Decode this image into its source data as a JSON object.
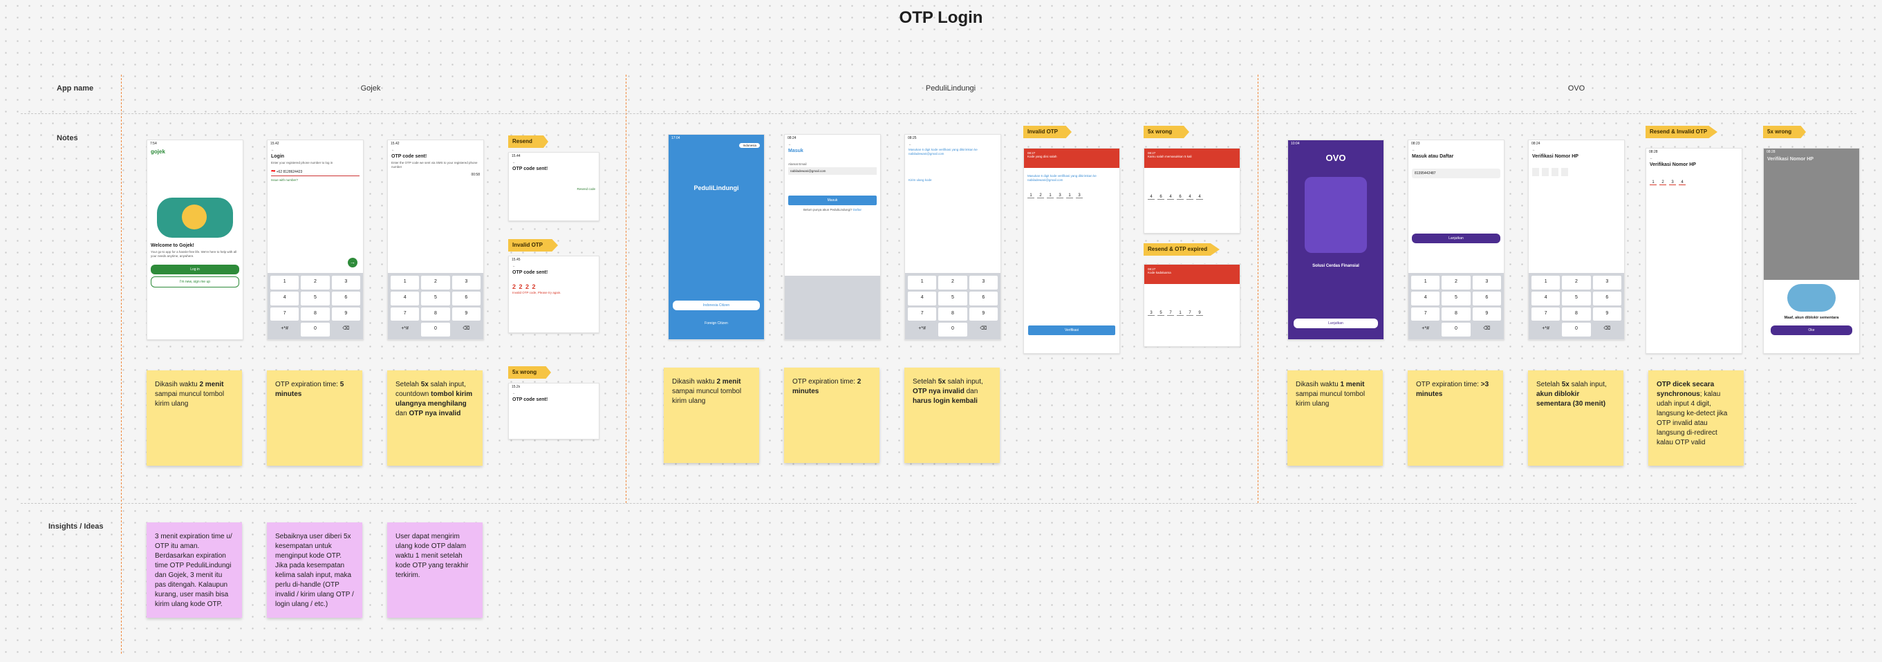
{
  "page_title": "OTP Login",
  "row_labels": {
    "app_name": "App name",
    "notes": "Notes",
    "insights": "Insights / Ideas"
  },
  "sections": [
    "Gojek",
    "PeduliLindungi",
    "OVO"
  ],
  "tags": {
    "resend": "Resend",
    "invalid_otp": "Invalid OTP",
    "five_wrong": "5x wrong",
    "resend_otp_expired": "Resend & OTP expired",
    "resend_invalid_otp": "Resend & Invalid OTP"
  },
  "screens": {
    "gojek_welcome": {
      "time": "7:54",
      "brand": "gojek",
      "heading": "Welcome to Gojek!",
      "text": "Your go-to app for a hassle-free life. We're here to help with all your needs anytime, anywhere.",
      "login": "Log in",
      "signup": "I'm new, sign me up"
    },
    "gojek_login": {
      "time": "15.42",
      "heading": "Login",
      "text": "Enter your registered phone number to log in",
      "phone": "8128624423",
      "link": "Issue with number?"
    },
    "gojek_otp_sent": {
      "time": "15.42",
      "heading": "OTP code sent!",
      "text": "Enter the OTP code we sent via SMS to your registered phone number",
      "timer": "00:58"
    },
    "gojek_resend": {
      "time": "15.44",
      "heading": "OTP code sent!",
      "link": "Resend code"
    },
    "gojek_invalid": {
      "time": "15.45",
      "heading": "OTP code sent!",
      "code": "2 2 2 2",
      "error": "Invalid OTP code, Please try again."
    },
    "gojek_wrong": {
      "time": "15.2x",
      "heading": "OTP code sent!"
    },
    "peduli_splash": {
      "time": "17:04",
      "brand": "PeduliLindungi",
      "lang": "Indonesia",
      "primary": "Indonesia Citizen",
      "secondary": "Foreign Citizen"
    },
    "peduli_login": {
      "time": "08:24",
      "heading": "Masuk",
      "field_label": "Alamat Email",
      "field_value": "nabiladewani@gmail.com",
      "button": "Masuk",
      "link": "Belum punya akun PeduliLindungi?",
      "link_action": "Daftar"
    },
    "peduli_otp": {
      "time": "08:25",
      "text": "Masukan 6 digit kode verifikasi yang dikirimkan ke nabiladewani@gmail.com",
      "link": "Kirim ulang kode"
    },
    "peduli_invalid": {
      "time": "08:27",
      "error": "Kode yang diisi salah",
      "text": "Masukan 6 digit kode verifikasi yang dikirimkan ke nabiladewani@gmail.com",
      "digits": [
        "1",
        "2",
        "1",
        "3",
        "1",
        "3"
      ],
      "button": "Verifikasi"
    },
    "peduli_wrong": {
      "time": "08:27",
      "error": "Kamu salah memasukkan 5 kali",
      "digits": [
        "4",
        "6",
        "4",
        "6",
        "4",
        "4"
      ]
    },
    "peduli_expired": {
      "time": "08:27",
      "error": "Kode kadaluarsa",
      "digits": [
        "3",
        "5",
        "7",
        "1",
        "7",
        "9"
      ]
    },
    "ovo_splash": {
      "time": "10:04",
      "brand": "OVO",
      "tagline": "Solusi Cerdas Finansial",
      "button": "Lanjutkan"
    },
    "ovo_register": {
      "time": "08:23",
      "heading": "Masuk atau Daftar",
      "phone": "81395442487",
      "button": "Lanjutkan"
    },
    "ovo_verify": {
      "time": "08:24",
      "heading": "Verifikasi Nomor HP"
    },
    "ovo_invalid": {
      "time": "08:28",
      "heading": "Verifikasi Nomor HP",
      "digits": [
        "1",
        "2",
        "3",
        "4"
      ]
    },
    "ovo_blocked": {
      "time": "08:28",
      "heading": "Verifikasi Nomor HP",
      "message": "Maaf, akun diblokir sementara",
      "button": "Oke"
    }
  },
  "keypad": [
    "1",
    "2",
    "3",
    "4",
    "5",
    "6",
    "7",
    "8",
    "9",
    "+*#",
    "0",
    "⌫"
  ],
  "notes": {
    "n1": {
      "a": "Dikasih waktu ",
      "b": "2 menit",
      "c": " sampai muncul tombol kirim ulang"
    },
    "n2": {
      "a": "OTP expiration time: ",
      "b": "5 minutes"
    },
    "n3": {
      "a": "Setelah ",
      "b": "5x",
      "c": " salah input, countdown ",
      "d": "tombol kirim ulangnya menghilang",
      "e": " dan ",
      "f": "OTP nya invalid"
    },
    "n4": {
      "a": "Dikasih waktu ",
      "b": "2 menit",
      "c": " sampai muncul tombol kirim ulang"
    },
    "n5": {
      "a": "OTP expiration time: ",
      "b": "2 minutes"
    },
    "n6": {
      "a": "Setelah ",
      "b": "5x",
      "c": " salah input, ",
      "d": "OTP nya invalid",
      "e": " dan ",
      "f": "harus login kembali"
    },
    "n7": {
      "a": "Dikasih waktu ",
      "b": "1 menit",
      "c": " sampai muncul tombol kirim ulang"
    },
    "n8": {
      "a": "OTP expiration time: ",
      "b": ">3 minutes"
    },
    "n9": {
      "a": "Setelah ",
      "b": "5x",
      "c": " salah input, ",
      "d": "akun diblokir sementara (30 menit)"
    },
    "n10": {
      "a": "OTP dicek secara synchronous",
      "b": "; kalau udah input 4 digit, langsung ke-detect jika OTP invalid atau langsung di-redirect kalau OTP valid"
    }
  },
  "insights": [
    "3 menit expiration time u/ OTP itu aman. Berdasarkan expiration time OTP PeduliLindungi dan Gojek, 3 menit itu pas ditengah. Kalaupun kurang, user masih bisa kirim ulang kode OTP.",
    "Sebaiknya user diberi 5x kesempatan untuk menginput kode OTP. Jika pada kesempatan kelima salah input, maka perlu di-handle (OTP invalid / kirim ulang OTP / login ulang / etc.)",
    "User dapat mengirim ulang kode OTP dalam waktu 1 menit setelah kode OTP yang terakhir terkirim."
  ],
  "colors": {
    "sticky_yellow": "#fde68a",
    "sticky_pink": "#efbef6",
    "tag": "#f6c443",
    "divider": "#f0883e",
    "gojek_green": "#2e8b3a",
    "peduli_blue": "#3d8fd6",
    "ovo_purple": "#4b2c8f",
    "error_red": "#d93b2b"
  }
}
